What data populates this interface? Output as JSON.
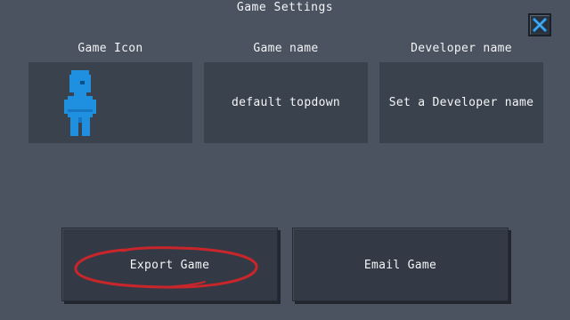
{
  "dialog": {
    "title": "Game Settings",
    "close_icon": "close-x-icon",
    "accent_color": "#1f8fe0"
  },
  "fields": {
    "icon": {
      "label": "Game Icon",
      "image": "pixel-robot-character-icon",
      "color": "#1f8fe0"
    },
    "name": {
      "label": "Game name",
      "value": "default topdown"
    },
    "developer": {
      "label": "Developer name",
      "value": "Set a Developer name"
    }
  },
  "actions": {
    "export_label": "Export Game",
    "email_label": "Email Game"
  },
  "annotation": {
    "shape": "hand-drawn-ellipse",
    "color": "#c8262a",
    "target": "export-game-button"
  }
}
